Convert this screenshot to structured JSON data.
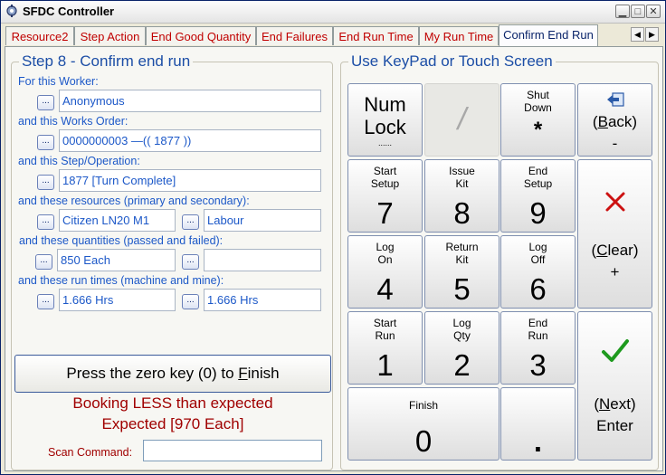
{
  "window": {
    "title": "SFDC Controller",
    "minimize_icon": "minimize-icon",
    "restore_icon": "restore-icon",
    "close_icon": "close-icon"
  },
  "tabs": [
    {
      "label": "Resource2"
    },
    {
      "label": "Step Action"
    },
    {
      "label": "End Good Quantity"
    },
    {
      "label": "End Failures"
    },
    {
      "label": "End Run Time"
    },
    {
      "label": "My Run Time"
    },
    {
      "label": "Confirm End Run",
      "active": true
    }
  ],
  "tab_scroll": {
    "left": "◀",
    "right": "▶"
  },
  "step": {
    "title": "Step 8 - Confirm end run",
    "worker_label": "For this Worker:",
    "worker_value": "Anonymous",
    "works_order_label": "and this Works Order:",
    "works_order_value": "0000000003    —(( 1877 ))",
    "operation_label": "and this Step/Operation:",
    "operation_value": "1877 [Turn Complete]",
    "resources_label": "and these resources (primary and secondary):",
    "resource_primary": "Citizen LN20 M1",
    "resource_secondary": "Labour",
    "quantities_label": "and these quantities (passed and failed):",
    "quantity_passed": "850 Each",
    "quantity_failed": "",
    "runtimes_label": "and these run times (machine and mine):",
    "runtime_machine": "1.666 Hrs",
    "runtime_mine": "1.666 Hrs",
    "browse_label": "...",
    "finish_button_pre": "Press the zero key (0) to ",
    "finish_button_key": "F",
    "finish_button_post": "inish",
    "warning_line1": "Booking LESS than expected",
    "warning_line2": "Expected [970 Each]",
    "scan_label": "Scan Command:",
    "scan_value": ""
  },
  "keypad": {
    "title": "Use KeyPad or Touch Screen",
    "numlock_line1": "Num",
    "numlock_line2": "Lock",
    "numlock_sub": "......",
    "slash": "/",
    "shutdown_label1": "Shut",
    "shutdown_label2": "Down",
    "shutdown_key": "*",
    "back_icon": "back-arrow-icon",
    "back_pre": "(",
    "back_key": "B",
    "back_post": "ack)",
    "back_sub": "-",
    "k7_l1": "Start",
    "k7_l2": "Setup",
    "k7": "7",
    "k8_l1": "Issue",
    "k8_l2": "Kit",
    "k8": "8",
    "k9_l1": "End",
    "k9_l2": "Setup",
    "k9": "9",
    "k4_l1": "Log",
    "k4_l2": "On",
    "k4": "4",
    "k5_l1": "Return",
    "k5_l2": "Kit",
    "k5": "5",
    "k6_l1": "Log",
    "k6_l2": "Off",
    "k6": "6",
    "k1_l1": "Start",
    "k1_l2": "Run",
    "k1": "1",
    "k2_l1": "Log",
    "k2_l2": "Qty",
    "k2": "2",
    "k3_l1": "End",
    "k3_l2": "Run",
    "k3": "3",
    "k0_l1": "Finish",
    "k0": "0",
    "dot": ".",
    "clear_icon": "clear-x-icon",
    "clear_pre": "(",
    "clear_key": "C",
    "clear_post": "lear)",
    "clear_sub": "+",
    "next_icon": "checkmark-icon",
    "next_pre": "(",
    "next_key": "N",
    "next_post": "ext)",
    "next_sub": "Enter"
  },
  "colors": {
    "label_blue": "#1C58C8",
    "title_blue": "#1C4EA6",
    "warning_red": "#A00000",
    "tab_red": "#C00000",
    "clear_red": "#CC1111",
    "check_green": "#1E9A1E"
  }
}
